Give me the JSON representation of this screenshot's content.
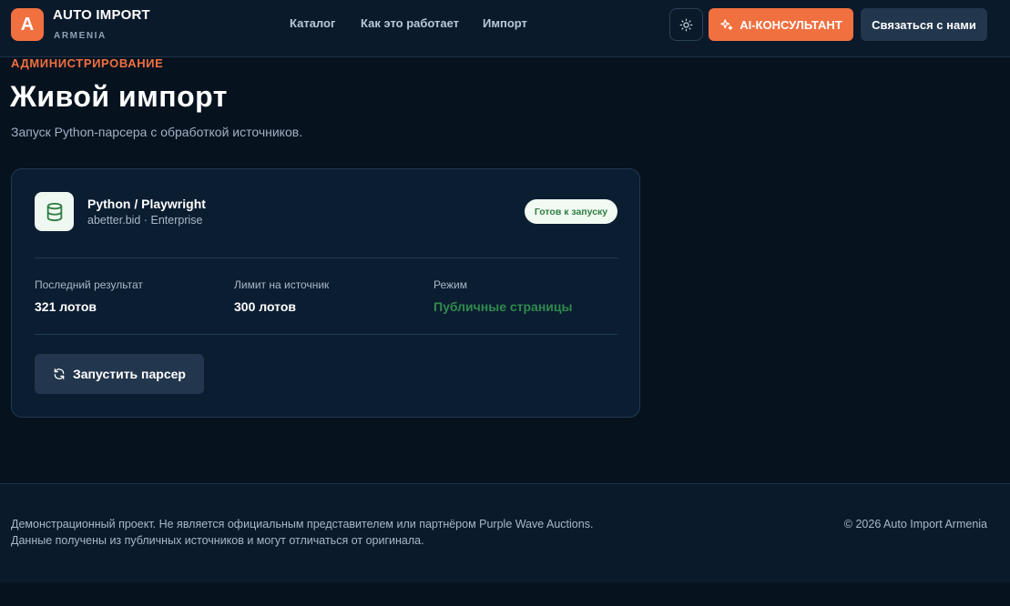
{
  "header": {
    "logo_letter": "A",
    "brand_title": "AUTO IMPORT",
    "brand_subtitle": "ARMENIA",
    "nav": [
      {
        "label": "Каталог"
      },
      {
        "label": "Как это работает"
      },
      {
        "label": "Импорт"
      }
    ],
    "theme_icon": "sun-icon",
    "ai_button_label": "AI-КОНСУЛЬТАНТ",
    "contact_button_label": "Связаться с нами"
  },
  "page": {
    "eyebrow": "АДМИНИСТРИРОВАНИЕ",
    "title": "Живой импорт",
    "description": "Запуск Python-парсера с обработкой источников."
  },
  "card": {
    "icon": "database-icon",
    "source_title": "Python / Playwright",
    "source_subtitle": "abetter.bid · Enterprise",
    "status": "Готов к запуску",
    "stats": [
      {
        "label": "Последний результат",
        "value": "321 лотов"
      },
      {
        "label": "Лимит на источник",
        "value": "300 лотов"
      },
      {
        "label": "Режим",
        "value": "Публичные страницы"
      }
    ],
    "run_button_label": "Запустить парсер"
  },
  "footer": {
    "line1": "Демонстрационный проект. Не является официальным представителем или партнёром Purple Wave Auctions.",
    "line2": "Данные получены из публичных источников и могут отличаться от оригинала.",
    "copyright": "© 2026 Auto Import Armenia"
  },
  "colors": {
    "accent": "#f07040",
    "background": "#07121f",
    "surface": "#0b1d31",
    "success": "#2f8a4e"
  }
}
